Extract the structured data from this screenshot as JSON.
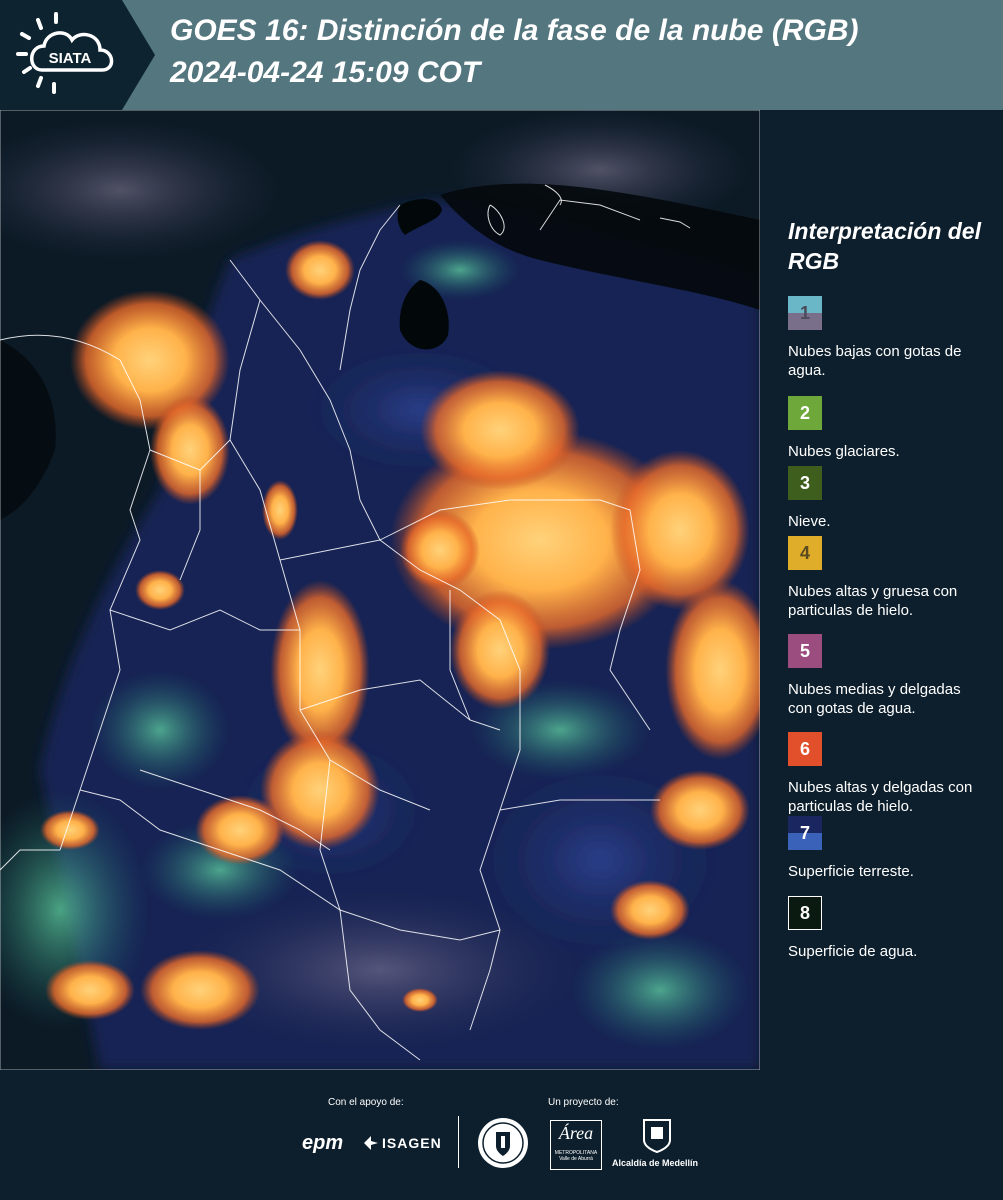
{
  "header": {
    "logo_text": "SIATA",
    "title_line1": "GOES 16: Distinción de la fase de la nube (RGB)",
    "title_line2": "2024-04-24 15:09 COT"
  },
  "legend": {
    "title": "Interpretación del RGB",
    "items": [
      {
        "number": "1",
        "label": "Nubes bajas con gotas de agua.",
        "colors": [
          "#6ab7c8",
          "#7a6f8a"
        ],
        "text_color": "#4a4a5a"
      },
      {
        "number": "2",
        "label": "Nubes glaciares.",
        "colors": [
          "#6fa83a"
        ],
        "text_color": "#ffffff"
      },
      {
        "number": "3",
        "label": "Nieve.",
        "colors": [
          "#3d5e1c"
        ],
        "text_color": "#ffffff"
      },
      {
        "number": "4",
        "label": "Nubes altas y gruesa con particulas de hielo.",
        "colors": [
          "#e0ad2a"
        ],
        "text_color": "#5a4a20"
      },
      {
        "number": "5",
        "label": "Nubes medias y delgadas con gotas de agua.",
        "colors": [
          "#9a4d7e"
        ],
        "text_color": "#ffffff"
      },
      {
        "number": "6",
        "label": "Nubes altas y delgadas con particulas de hielo.",
        "colors": [
          "#e2502b"
        ],
        "text_color": "#ffffff"
      },
      {
        "number": "7",
        "label": "Superficie terreste.",
        "colors": [
          "#1a2660",
          "#3a62b8"
        ],
        "text_color": "#ffffff"
      },
      {
        "number": "8",
        "label": "Superficie de agua.",
        "colors": [
          "#0a1a10"
        ],
        "text_color": "#ffffff"
      }
    ]
  },
  "footer": {
    "support_label": "Con el apoyo de:",
    "project_label": "Un proyecto de:",
    "sponsor1": "epm",
    "sponsor2": "ISAGEN",
    "partner_area_title": "Área",
    "partner_area_sub1": "METROPOLITANA",
    "partner_area_sub2": "Valle de Aburrá",
    "partner_alcaldia": "Alcaldía de Medellín"
  },
  "icons": [
    "siata-logo-icon",
    "univ-seal-icon",
    "alcaldia-shield-icon"
  ]
}
